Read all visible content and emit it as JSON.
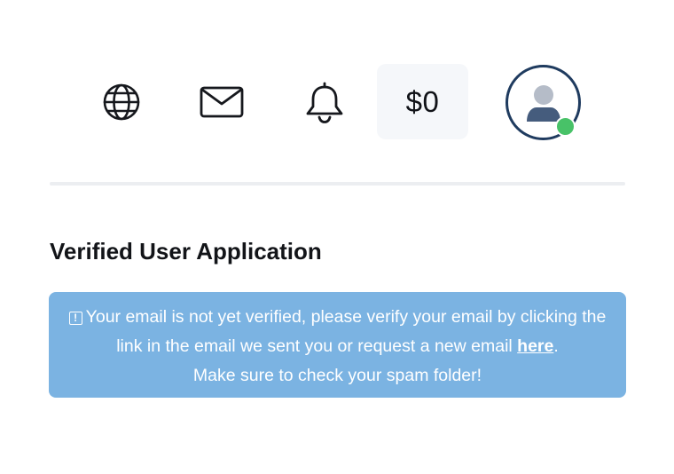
{
  "header": {
    "icons": {
      "language": "globe-icon",
      "messages": "mail-icon",
      "notifications": "bell-icon",
      "user": "user-avatar-icon"
    },
    "balance": "$0",
    "status": "online"
  },
  "main": {
    "title": "Verified User Application",
    "alert": {
      "text_before_link": "Your email is not yet verified, please verify your email by clicking the link in the email we sent you or request a new email",
      "link_label": "here",
      "after_link": ".",
      "second_line": "Make sure to check your spam folder!",
      "icon": "exclamation-icon"
    }
  },
  "colors": {
    "alert_background": "#7bb3e2",
    "avatar_ring": "#1f3b5f",
    "status_online": "#48c268",
    "balance_background": "#f5f7fa",
    "divider": "#eceef1"
  }
}
